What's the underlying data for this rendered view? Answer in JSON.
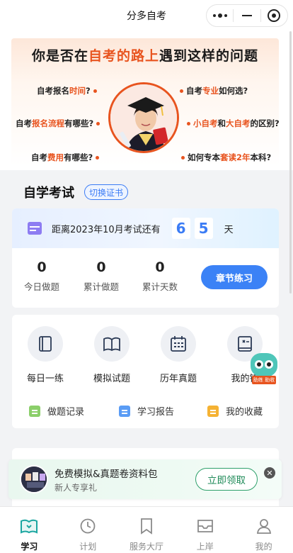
{
  "nav": {
    "title": "分多自考"
  },
  "banner": {
    "title_pre": "你是否在",
    "title_hl": "自考的路上",
    "title_post": "遇到这样的问题",
    "questions_left": [
      {
        "pre": "自考报名",
        "hl": "时间",
        "post": "?"
      },
      {
        "pre": "自考",
        "hl": "报名流程",
        "post": "有哪些?"
      },
      {
        "pre": "自考",
        "hl": "费用",
        "post": "有哪些?"
      }
    ],
    "questions_right": [
      {
        "pre": "自考",
        "hl": "专业",
        "post": "如何选?"
      },
      {
        "pre": "",
        "hl": "小自考",
        "mid": "和",
        "hl2": "大自考",
        "post": "的区别?"
      },
      {
        "pre": "如何专本",
        "hl": "套读2年",
        "post": "本科?"
      }
    ]
  },
  "study": {
    "heading": "自学考试",
    "switch_label": "切换证书",
    "countdown_text": "距离2023年10月考试还有",
    "days_digits": [
      "6",
      "5"
    ],
    "days_unit": "天",
    "stats": [
      {
        "value": "0",
        "label": "今日做题"
      },
      {
        "value": "0",
        "label": "累计做题"
      },
      {
        "value": "0",
        "label": "累计天数"
      }
    ],
    "practice_label": "章节练习"
  },
  "tools": {
    "items": [
      {
        "label": "每日一练",
        "icon": "notebook-icon"
      },
      {
        "label": "模拟试题",
        "icon": "open-book-icon"
      },
      {
        "label": "历年真题",
        "icon": "calendar-icon"
      },
      {
        "label": "我的错",
        "icon": "wrong-book-icon"
      }
    ],
    "links": [
      {
        "label": "做题记录",
        "color": "#8bcf6a"
      },
      {
        "label": "学习报告",
        "color": "#5a9cf5"
      },
      {
        "label": "我的收藏",
        "color": "#f5b233"
      }
    ]
  },
  "owl": {
    "tag": "助练 助收"
  },
  "promo": {
    "title": "免费模拟&真题卷资料包",
    "subtitle": "新人专享礼",
    "button": "立即领取",
    "close": "✕"
  },
  "tabs": [
    {
      "label": "学习",
      "icon": "book-icon",
      "active": true
    },
    {
      "label": "计划",
      "icon": "clock-icon",
      "active": false
    },
    {
      "label": "服务大厅",
      "icon": "bookmark-icon",
      "active": false
    },
    {
      "label": "上岸",
      "icon": "inbox-icon",
      "active": false
    },
    {
      "label": "我的",
      "icon": "user-icon",
      "active": false
    }
  ],
  "colors": {
    "accent": "#3b82f6",
    "highlight": "#e8541f",
    "active_tab": "#1aa6a0"
  }
}
